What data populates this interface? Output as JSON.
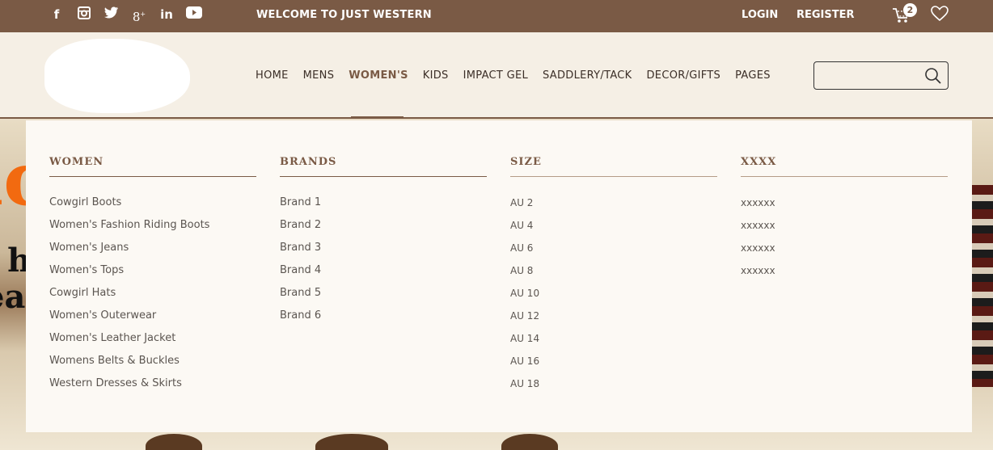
{
  "topbar": {
    "social": [
      "facebook-icon",
      "instagram-icon",
      "twitter-icon",
      "google-plus-icon",
      "linkedin-icon",
      "youtube-icon"
    ],
    "welcome": "WELCOME TO JUST WESTERN",
    "login": "LOGIN",
    "register": "REGISTER",
    "cart_count": "2"
  },
  "nav": {
    "items": [
      "HOME",
      "MENS",
      "WOMEN'S",
      "KIDS",
      "IMPACT GEL",
      "SADDLERY/TACK",
      "DECOR/GIFTS",
      "PAGES"
    ],
    "active": "WOMEN'S"
  },
  "search": {
    "placeholder": ""
  },
  "hero": {
    "big": "ic",
    "line1": "l h",
    "line2": "ea"
  },
  "mega": {
    "columns": [
      {
        "title": "WOMEN",
        "items": [
          "Cowgirl Boots",
          "Women's Fashion Riding Boots",
          "Women's Jeans",
          "Women's Tops",
          "Cowgirl Hats",
          "Women's Outerwear",
          "Women's Leather Jacket",
          "Womens Belts & Buckles",
          "Western Dresses & Skirts"
        ]
      },
      {
        "title": "BRANDS",
        "items": [
          "Brand 1",
          "Brand 2",
          "Brand 3",
          "Brand 4",
          "Brand 5",
          "Brand 6"
        ]
      },
      {
        "title": "SIZE",
        "items": [
          "AU 2",
          "AU 4",
          "AU 6",
          "AU 8",
          "AU 10",
          "AU 12",
          "AU 14",
          "AU 16",
          "AU 18"
        ]
      },
      {
        "title": "XXXX",
        "items": [
          "xxxxxx",
          "xxxxxx",
          "xxxxxx",
          "xxxxxx"
        ]
      }
    ]
  },
  "colors": {
    "brand": "#7a5a45",
    "header_bg": "#f5efe5",
    "menu_bg": "#fcf9f4"
  }
}
